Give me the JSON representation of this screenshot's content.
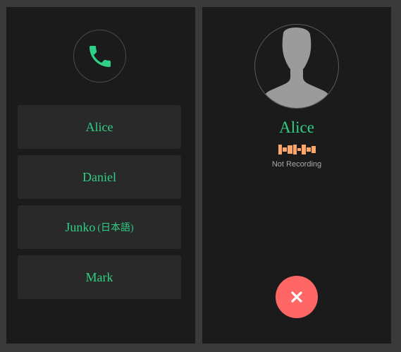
{
  "contacts": [
    {
      "name": "Alice",
      "suffix": ""
    },
    {
      "name": "Daniel",
      "suffix": ""
    },
    {
      "name": "Junko",
      "suffix": "(日本語)"
    },
    {
      "name": "Mark",
      "suffix": ""
    }
  ],
  "call": {
    "caller_name": "Alice",
    "recording_status": "Not Recording"
  },
  "icons": {
    "dial": "phone-icon",
    "avatar": "person-silhouette-icon",
    "waveform": "audio-waveform-icon",
    "hangup": "close-icon"
  },
  "colors": {
    "accent": "#2ecf86",
    "waveform": "#ffa76a",
    "hangup": "#ff6666",
    "panel": "#1b1b1b",
    "item": "#292929"
  }
}
